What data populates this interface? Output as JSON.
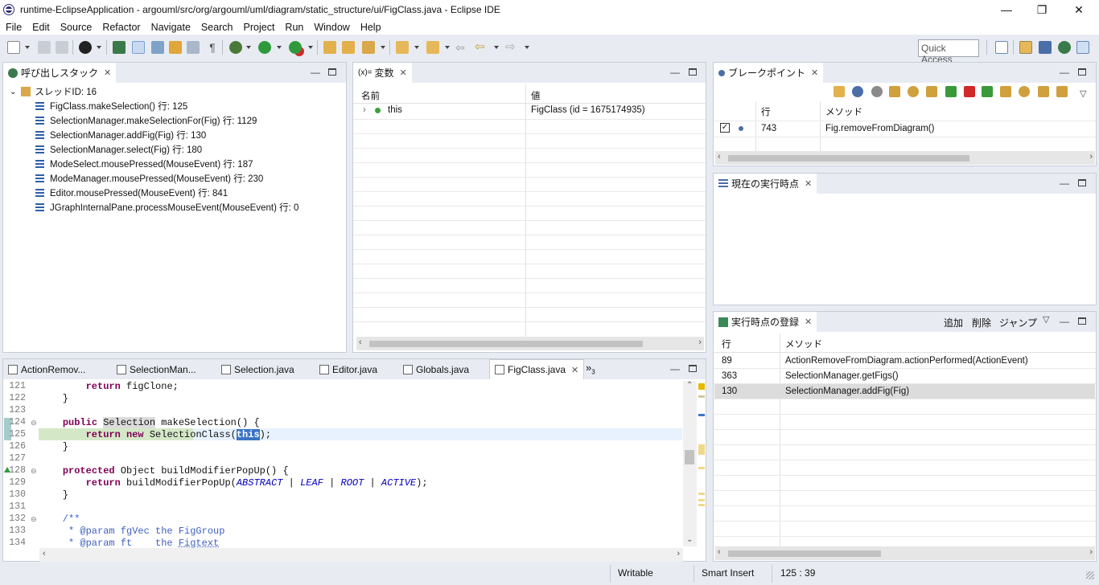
{
  "window": {
    "title": "runtime-EclipseApplication - argouml/src/org/argouml/uml/diagram/static_structure/ui/FigClass.java - Eclipse IDE",
    "minimize": "—",
    "maximize": "❐",
    "close": "✕"
  },
  "menu": [
    "File",
    "Edit",
    "Source",
    "Refactor",
    "Navigate",
    "Search",
    "Project",
    "Run",
    "Window",
    "Help"
  ],
  "toolbar": {
    "quick_access_placeholder": "Quick Access"
  },
  "callstack": {
    "tab_label": "呼び出しスタック",
    "thread": "スレッドID: 16",
    "frames": [
      "FigClass.makeSelection() 行: 125",
      "SelectionManager.makeSelectionFor(Fig) 行: 1129",
      "SelectionManager.addFig(Fig) 行: 130",
      "SelectionManager.select(Fig) 行: 180",
      "ModeSelect.mousePressed(MouseEvent) 行: 187",
      "ModeManager.mousePressed(MouseEvent) 行: 230",
      "Editor.mousePressed(MouseEvent) 行: 841",
      "JGraphInternalPane.processMouseEvent(MouseEvent) 行: 0"
    ]
  },
  "variables": {
    "tab_label": "変数",
    "tab_prefix": "(x)=",
    "col_name": "名前",
    "col_value": "値",
    "rows": [
      {
        "name": "this",
        "value": "FigClass (id = 1675174935)"
      }
    ]
  },
  "breakpoints": {
    "tab_label": "ブレークポイント",
    "col_line": "行",
    "col_method": "メソッド",
    "rows": [
      {
        "checked": true,
        "line": "743",
        "method": "Fig.removeFromDiagram()"
      }
    ]
  },
  "current_point": {
    "tab_label": "現在の実行時点"
  },
  "registered_points": {
    "tab_label": "実行時点の登録",
    "actions": [
      "追加",
      "削除",
      "ジャンプ"
    ],
    "col_line": "行",
    "col_method": "メソッド",
    "rows": [
      {
        "line": "89",
        "method": "ActionRemoveFromDiagram.actionPerformed(ActionEvent)"
      },
      {
        "line": "363",
        "method": "SelectionManager.getFigs()"
      },
      {
        "line": "130",
        "method": "SelectionManager.addFig(Fig)",
        "selected": true
      }
    ]
  },
  "editor": {
    "tabs": [
      "ActionRemov...",
      "SelectionMan...",
      "Selection.java",
      "Editor.java",
      "Globals.java",
      "FigClass.java"
    ],
    "active_tab": "FigClass.java",
    "overflow": "»",
    "overflow_count": "3",
    "line_numbers": [
      "121",
      "122",
      "123",
      "124",
      "125",
      "126",
      "127",
      "128",
      "129",
      "130",
      "131",
      "132",
      "133",
      "134"
    ]
  },
  "status": {
    "writable": "Writable",
    "insert_mode": "Smart Insert",
    "position": "125 : 39"
  },
  "colors": {
    "accent": "#2d5fa7",
    "current_line_bg": "#d4e8c8",
    "selection_bg": "#dcdcdc",
    "keyword": "#7f0055",
    "constant": "#0000c0"
  }
}
